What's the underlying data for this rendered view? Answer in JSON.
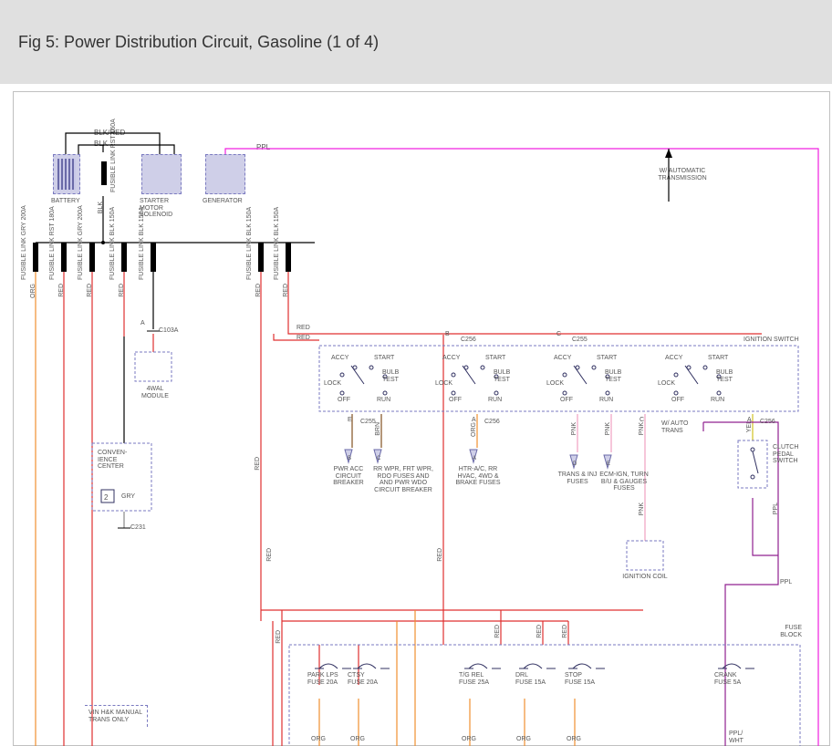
{
  "title": "Fig 5: Power Distribution Circuit, Gasoline (1 of 4)",
  "labels": {
    "blkred": "BLK/RED",
    "blk": "BLK",
    "ppl": "PPL",
    "battery": "BATTERY",
    "fusible_link_rst_160a": "FUSIBLE LINK RST 160A",
    "starter": "STARTER MOTOR SOLENOID",
    "generator": "GENERATOR",
    "auto_trans": "W/ AUTOMATIC TRANSMISSION",
    "flinks": [
      "FUSIBLE LINK GRY 200A",
      "FUSIBLE LINK RST 180A",
      "FUSIBLE LINK GRY 200A",
      "FUSIBLE LINK BLK 150A",
      "FUSIBLE LINK BLK 150A",
      "FUSIBLE LINK BLK 150A",
      "FUSIBLE LINK BLK 150A"
    ],
    "flink_colors": [
      "ORG",
      "RED",
      "RED",
      "RED",
      "",
      "RED",
      "RED"
    ],
    "c103a": "C103A",
    "a": "A",
    "fwal": "4WAL MODULE",
    "conv_center": "CONVEN- IENCE CENTER",
    "gry_num": "2",
    "gry": "GRY",
    "c231": "C231",
    "vin_hk": "VIN H&K MANUAL TRANS ONLY",
    "ignition_switch": "IGNITION SWITCH",
    "sw_labels": {
      "accy": "ACCY",
      "start": "START",
      "lock": "LOCK",
      "off": "OFF",
      "run": "RUN",
      "bulb": "BULB TEST"
    },
    "connectors": {
      "c255": "C255",
      "c256": "C256",
      "e": "E",
      "b": "B",
      "a": "A",
      "c": "C",
      "d": "D",
      "pnk": "PNK",
      "org": "ORG",
      "yel": "YEL",
      "brn": "BRN"
    },
    "arrows": {
      "b_pwr": "PWR ACC CIRCUIT BREAKER",
      "c_rr": "RR WPR, FRT WPR, RDO FUSES AND AND PWR WDO CIRCUIT BREAKER",
      "htr": "HTR-A/C, RR HVAC, 4WD & BRAKE FUSES",
      "d_trans": "TRANS & INJ FUSES",
      "e_ecm": "ECM-IGN, TURN B/U & GAUGES FUSES"
    },
    "ign_coil": "IGNITION COIL",
    "clutch": "CLUTCH PEDAL SWITCH",
    "wauto": "W/ AUTO TRANS",
    "fuse_block": "FUSE BLOCK",
    "fuses": {
      "park": "PARK LPS FUSE 20A",
      "ctsy": "CTSY FUSE 20A",
      "tgrel": "T/G REL FUSE 25A",
      "drl": "DRL FUSE 15A",
      "stop": "STOP FUSE 15A",
      "crank": "CRANK FUSE 5A"
    },
    "pplwht": "PPL/ WHT"
  }
}
